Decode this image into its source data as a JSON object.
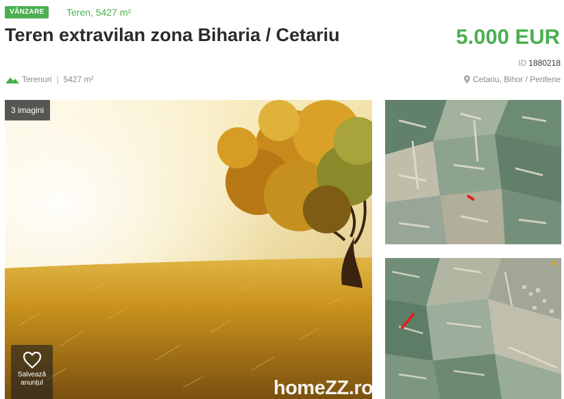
{
  "listing": {
    "badge": "VÂNZARE",
    "subtype": "Teren, 5427 m²",
    "title": "Teren extravilan zona Biharia / Cetariu",
    "price": "5.000 EUR",
    "id_label": "ID",
    "id_value": "1880218",
    "category": "Terenuri",
    "area": "5427 m²",
    "location": "Cetariu, Bihor / Periferie"
  },
  "gallery": {
    "image_count": "3 imagini",
    "save_line1": "Salvează",
    "save_line2": "anunțul",
    "watermark": "homeZZ.ro"
  },
  "colors": {
    "accent": "#4caf50",
    "title": "#2b2b2b",
    "muted": "#888888"
  },
  "icons": [
    "mountain-icon",
    "location-pin-icon",
    "heart-icon"
  ]
}
